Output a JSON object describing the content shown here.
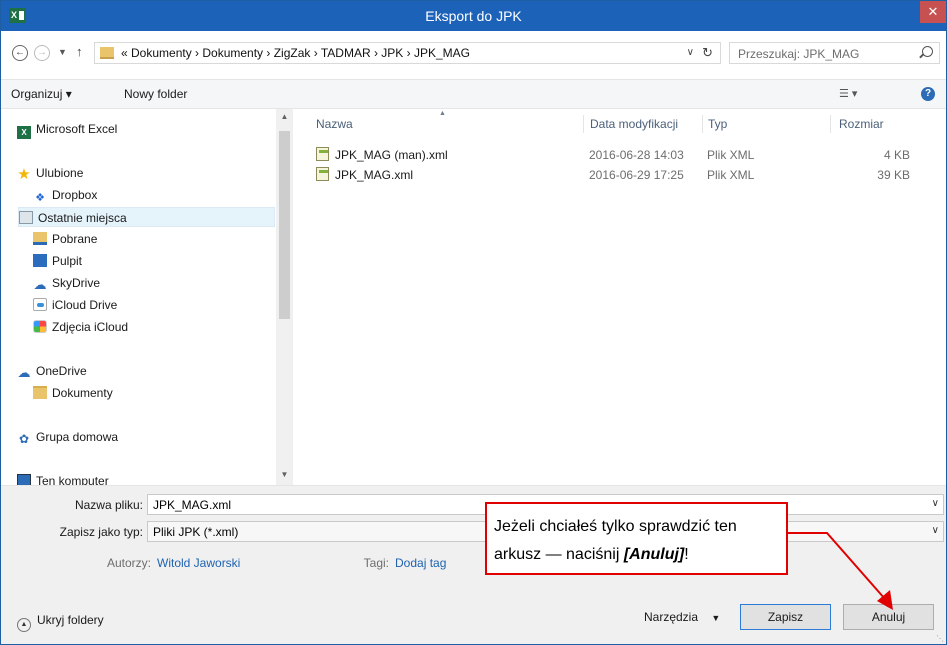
{
  "window": {
    "title": "Eksport do JPK",
    "app_icon": "X",
    "close_glyph": "✕"
  },
  "address_bar": {
    "path": "« Dokumenty  ›  Dokumenty  ›  ZigZak  ›  TADMAR  ›  JPK  ›  JPK_MAG",
    "search_placeholder": "Przeszukaj: JPK_MAG"
  },
  "toolbar": {
    "organize_label": "Organizuj ▾",
    "new_folder_label": "Nowy folder",
    "help_glyph": "?"
  },
  "sidebar": {
    "items": [
      {
        "label": "Microsoft Excel",
        "icon": "excel-icon"
      },
      {
        "label": "Ulubione",
        "icon": "star-icon"
      },
      {
        "label": "Dropbox",
        "icon": "dropbox-icon"
      },
      {
        "label": "Ostatnie miejsca",
        "icon": "recent-places-icon",
        "selected": true
      },
      {
        "label": "Pobrane",
        "icon": "downloads-icon"
      },
      {
        "label": "Pulpit",
        "icon": "desktop-icon"
      },
      {
        "label": "SkyDrive",
        "icon": "skydrive-icon"
      },
      {
        "label": "iCloud Drive",
        "icon": "icloud-drive-icon"
      },
      {
        "label": "Zdjęcia iCloud",
        "icon": "icloud-photos-icon"
      },
      {
        "label": "OneDrive",
        "icon": "onedrive-icon"
      },
      {
        "label": "Dokumenty",
        "icon": "folder-icon"
      },
      {
        "label": "Grupa domowa",
        "icon": "homegroup-icon"
      },
      {
        "label": "Ten komputer",
        "icon": "computer-icon"
      }
    ]
  },
  "file_list": {
    "columns": {
      "name": "Nazwa",
      "date": "Data modyfikacji",
      "type": "Typ",
      "size": "Rozmiar"
    },
    "rows": [
      {
        "name": "JPK_MAG (man).xml",
        "date": "2016-06-28 14:03",
        "type": "Plik XML",
        "size": "4 KB"
      },
      {
        "name": "JPK_MAG.xml",
        "date": "2016-06-29 17:25",
        "type": "Plik XML",
        "size": "39 KB"
      }
    ]
  },
  "form": {
    "filename_label": "Nazwa pliku:",
    "filename_value": "JPK_MAG.xml",
    "filetype_label": "Zapisz jako typ:",
    "filetype_value": "Pliki JPK (*.xml)",
    "authors_label": "Autorzy:",
    "authors_value": "Witold Jaworski",
    "tags_label": "Tagi:",
    "tags_value": "Dodaj tag"
  },
  "footer": {
    "hide_folders_label": "Ukryj foldery",
    "tools_label": "Narzędzia",
    "save_label": "Zapisz",
    "cancel_label": "Anuluj"
  },
  "annotation": {
    "line1": "Jeżeli chciałeś tylko sprawdzić ten",
    "line2_prefix": "arkusz — naciśnij ",
    "line2_emphasis": "[Anuluj]",
    "line2_suffix": "!",
    "color": "#e00000"
  }
}
